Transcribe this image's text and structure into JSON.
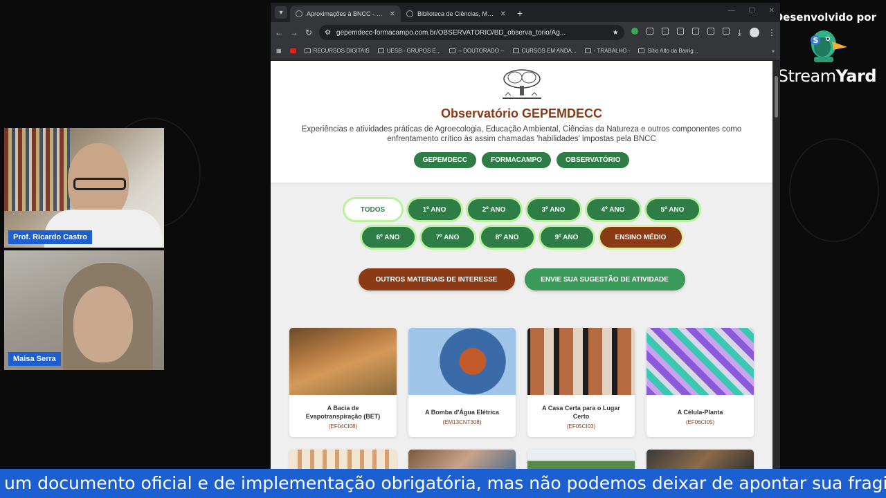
{
  "branding": {
    "developed_by": "Desenvolvido por",
    "name_light": "Stream",
    "name_bold": "Yard"
  },
  "participants": [
    {
      "name": "Prof. Ricardo Castro"
    },
    {
      "name": "Maisa Serra"
    }
  ],
  "browser": {
    "tabs": [
      {
        "label": "Aproximações à BNCC - Observ...",
        "active": true
      },
      {
        "label": "Biblioteca de Ciências, Meio Am...",
        "active": false
      }
    ],
    "url": "gepemdecc-formacampo.com.br/OBSERVATORIO/BD_observa_torio/Ag...",
    "bookmarks": [
      "RECURSOS DIGITAIS",
      "UESB - GRUPOS E...",
      "-- DOUTORADO --",
      "CURSOS EM ANDA...",
      "- TRABALHO -",
      "Sítio Alto da Barrig..."
    ]
  },
  "site": {
    "title": "Observatório GEPEMDECC",
    "description": "Experiências e atividades práticas de Agroecologia, Educação Ambiental, Ciências da Natureza e outros componentes como enfrentamento crítico às assim chamadas 'habilidades' impostas pela BNCC",
    "nav": [
      "GEPEMDECC",
      "FORMACAMPO",
      "OBSERVATÓRIO"
    ],
    "grades": [
      "TODOS",
      "1º ANO",
      "2º ANO",
      "3º ANO",
      "4º ANO",
      "5º ANO",
      "6º ANO",
      "7º ANO",
      "8º ANO",
      "9º ANO",
      "ENSINO MÉDIO"
    ],
    "actions": {
      "other_materials": "OUTROS MATERIAIS DE INTERESSE",
      "suggest": "ENVIE SUA SUGESTÃO DE ATIVIDADE"
    },
    "cards": [
      {
        "title": "A Bacia de Evapotranspiração (BET)",
        "code": "(EF04CI08)"
      },
      {
        "title": "A Bomba d'Água Elétrica",
        "code": "(EM13CNT308)"
      },
      {
        "title": "A Casa Certa para o Lugar Certo",
        "code": "(EF05CI03)"
      },
      {
        "title": "A Célula-Planta",
        "code": "(EF06CI05)"
      }
    ]
  },
  "caption": "um documento oficial e de implementação obrigatória, mas não podemos deixar de apontar sua fragilidad"
}
